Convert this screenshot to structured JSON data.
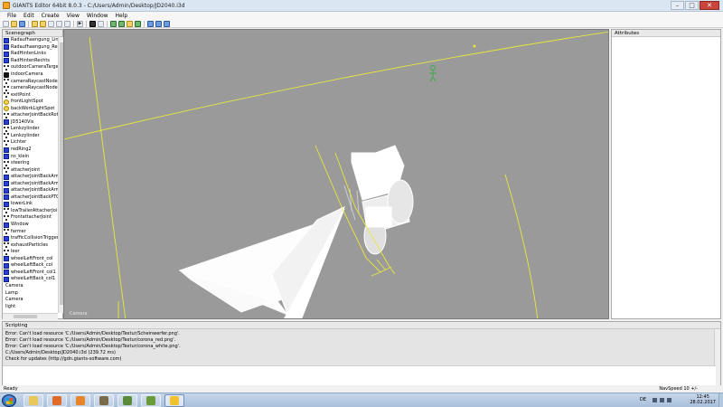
{
  "window": {
    "title": "GIANTS Editor 64bit 8.0.3 - C:/Users/Admin/Desktop/JD2040.i3d",
    "min_glyph": "–",
    "max_glyph": "□",
    "close_glyph": "✕"
  },
  "menu": [
    "File",
    "Edit",
    "Create",
    "View",
    "Window",
    "Help"
  ],
  "toolbar": {
    "icons": [
      "new-icon",
      "open-icon",
      "save-icon",
      "undo-icon",
      "redo-icon",
      "move-icon",
      "rotate-icon",
      "scale-icon",
      "play-icon",
      "camera-icon",
      "grid-icon",
      "terrain-icon",
      "foliage-icon",
      "spline-icon",
      "lights-icon",
      "shader-icon",
      "settings-icon",
      "help-icon"
    ]
  },
  "scenegraph": {
    "header": "Scenegraph",
    "items": [
      {
        "label": "Radaufhaengung_Lin",
        "icon": "cube"
      },
      {
        "label": "Radaufhaengung_Rec",
        "icon": "cube"
      },
      {
        "label": "RadHintenLinks",
        "icon": "cube"
      },
      {
        "label": "RadHintenRechts",
        "icon": "cube"
      },
      {
        "label": "outdoorCameraTarge",
        "icon": "transform"
      },
      {
        "label": "indoorCamera",
        "icon": "camera"
      },
      {
        "label": "cameraRaycastNode1",
        "icon": "transform"
      },
      {
        "label": "cameraRaycastNode2",
        "icon": "transform"
      },
      {
        "label": "exitPoint",
        "icon": "transform"
      },
      {
        "label": "frontLightSpot",
        "icon": "light"
      },
      {
        "label": "backWorkLightSpot",
        "icon": "light"
      },
      {
        "label": "attacherJointBackRot",
        "icon": "transform"
      },
      {
        "label": "JD5140Vis",
        "icon": "cube"
      },
      {
        "label": "Lenkzylinder",
        "icon": "transform"
      },
      {
        "label": "Lenkzylinder",
        "icon": "transform"
      },
      {
        "label": "Lichter",
        "icon": "transform"
      },
      {
        "label": "redRing2",
        "icon": "cube"
      },
      {
        "label": "ns_klein",
        "icon": "cube"
      },
      {
        "label": "steering",
        "icon": "transform"
      },
      {
        "label": "attacherJoint",
        "icon": "transform"
      },
      {
        "label": "attacherJointBackArm",
        "icon": "cube"
      },
      {
        "label": "attacherJointBackArm",
        "icon": "cube"
      },
      {
        "label": "attacherJointBackArm",
        "icon": "cube"
      },
      {
        "label": "attacherJointBackPTC",
        "icon": "cube"
      },
      {
        "label": "lowerLink",
        "icon": "cube"
      },
      {
        "label": "lowTrailerAttacherJoi",
        "icon": "transform"
      },
      {
        "label": "FrontattacherJoint",
        "icon": "transform"
      },
      {
        "label": "Window",
        "icon": "cube"
      },
      {
        "label": "farmer",
        "icon": "transform"
      },
      {
        "label": "trafficCollisionTrigger",
        "icon": "cube"
      },
      {
        "label": "exhaustParticles",
        "icon": "transform"
      },
      {
        "label": "leer",
        "icon": "transform"
      },
      {
        "label": "wheelLeftFront_col",
        "icon": "cube"
      },
      {
        "label": "wheelLeftBack_col",
        "icon": "cube"
      },
      {
        "label": "wheelLeftFront_col1",
        "icon": "cube"
      },
      {
        "label": "wheelLeftBack_col1",
        "icon": "cube"
      },
      {
        "label": "Camera",
        "icon": "none"
      },
      {
        "label": "Lamp",
        "icon": "none"
      },
      {
        "label": "Camera",
        "icon": "none"
      },
      {
        "label": "light",
        "icon": "none"
      }
    ]
  },
  "viewport": {
    "camera_label": "Camera",
    "background": "#9a9a9a",
    "guide_color": "#e8e83c"
  },
  "attributes": {
    "header": "Attributes"
  },
  "scripting": {
    "header": "Scripting",
    "log": [
      "Error: Can't load resource 'C:/Users/Admin/Desktop/Textur/Scheinwerfer.png'.",
      "Error: Can't load resource 'C:/Users/Admin/Desktop/Textur/corona_red.png'.",
      "Error: Can't load resource 'C:/Users/Admin/Desktop/Textur/corona_white.png'.",
      "C:/Users/Admin/Desktop/JD2040.i3d (239.72 ms)",
      "Check for updates (http://gdn.giants-software.com)"
    ]
  },
  "status": {
    "left": "Ready",
    "right": "NavSpeed 10 +/-"
  },
  "taskbar": {
    "apps": [
      {
        "name": "explorer",
        "color": "#e8c65a"
      },
      {
        "name": "media",
        "color": "#e06a2a"
      },
      {
        "name": "browser",
        "color": "#e8842a"
      },
      {
        "name": "game1",
        "color": "#7a6a4a"
      },
      {
        "name": "game2",
        "color": "#5a8a3a"
      },
      {
        "name": "minecraft",
        "color": "#6a9a3a"
      },
      {
        "name": "giants-editor",
        "color": "#f2c12e"
      }
    ],
    "lang": "DE",
    "time": "12:45",
    "date": "28.02.2017"
  }
}
